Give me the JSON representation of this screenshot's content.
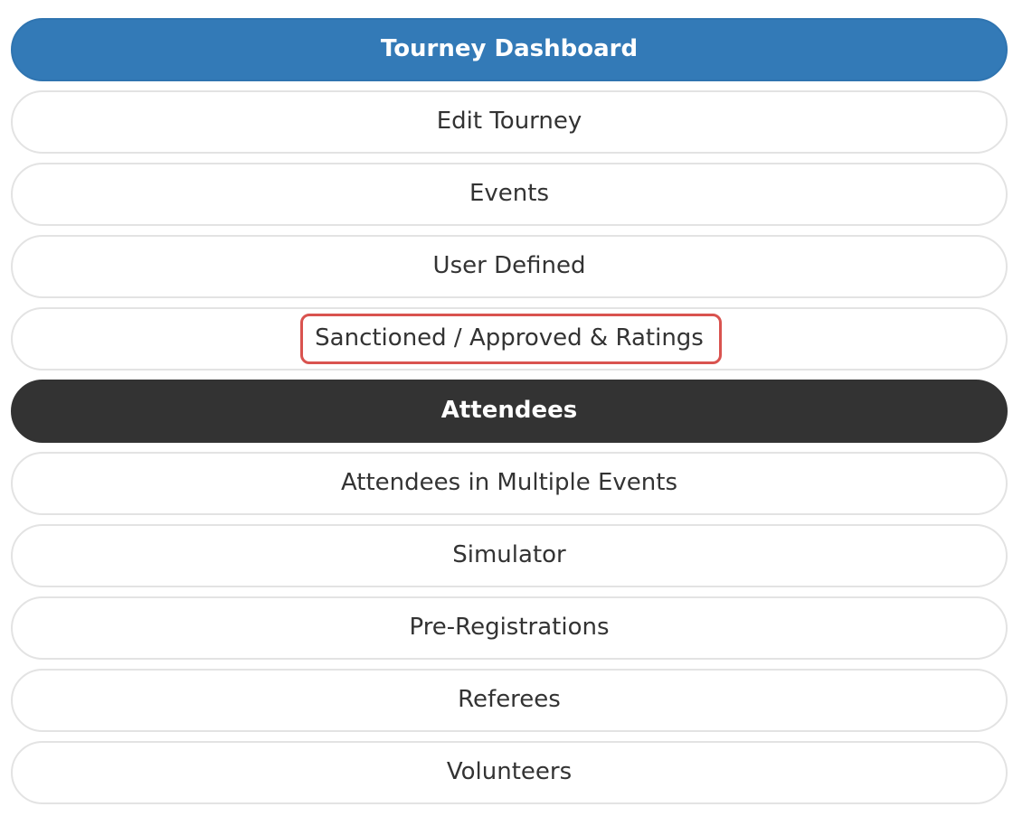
{
  "menu": {
    "items": [
      {
        "label": "Tourney Dashboard"
      },
      {
        "label": "Edit Tourney"
      },
      {
        "label": "Events"
      },
      {
        "label": "User Defined"
      },
      {
        "label": "Sanctioned / Approved & Ratings"
      },
      {
        "label": "Attendees"
      },
      {
        "label": "Attendees in Multiple Events"
      },
      {
        "label": "Simulator"
      },
      {
        "label": "Pre-Registrations"
      },
      {
        "label": "Referees"
      },
      {
        "label": "Volunteers"
      }
    ]
  },
  "colors": {
    "primary": "#337ab7",
    "active": "#333333",
    "highlight": "#d9534f",
    "border": "#e3e3e3"
  }
}
